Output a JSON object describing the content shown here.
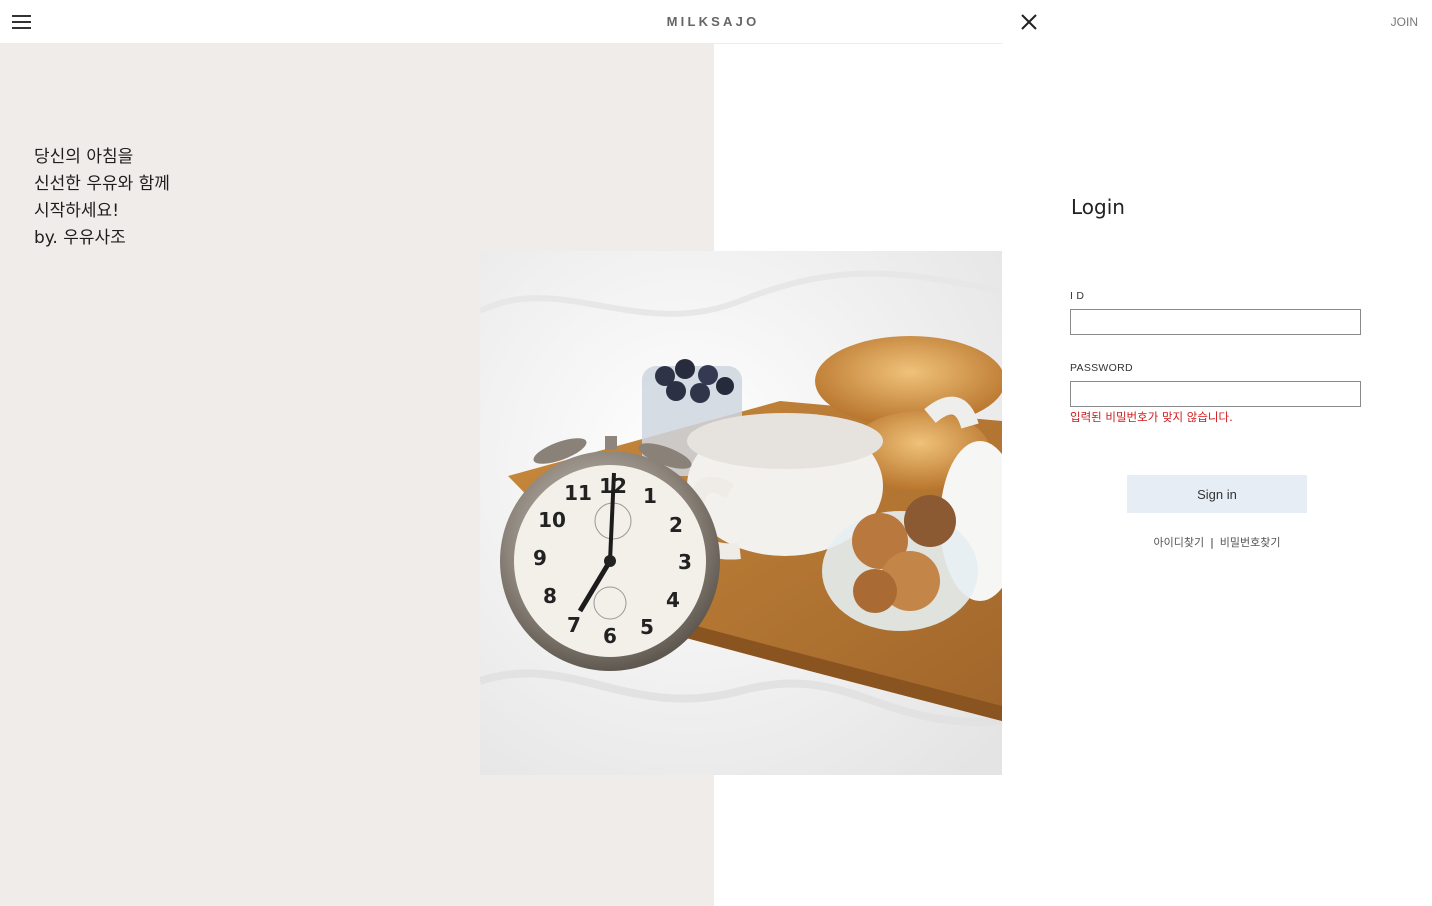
{
  "header": {
    "brand": "MILKSAJO",
    "menu_icon": "hamburger-menu-icon"
  },
  "hero": {
    "tagline": [
      "당신의 아침을",
      "신선한 우유와 함께",
      "시작하세요!",
      "by. 우유사조"
    ],
    "photo_description_icon": "breakfast-tray-alarm-clock-photo"
  },
  "login_panel": {
    "close_icon": "close-icon",
    "join_label": "JOIN",
    "title": "Login",
    "id_label": "I D",
    "id_value": "",
    "password_label": "PASSWORD",
    "password_value": "",
    "error_message": "입력된 비밀번호가 맞지 않습니다.",
    "signin_label": "Sign in",
    "find_id_label": "아이디찾기",
    "separator": "|",
    "find_password_label": "비밀번호찾기"
  },
  "colors": {
    "hero_background": "#f0ece9",
    "error": "#d11a1a",
    "signin_button": "#e6edf4"
  }
}
